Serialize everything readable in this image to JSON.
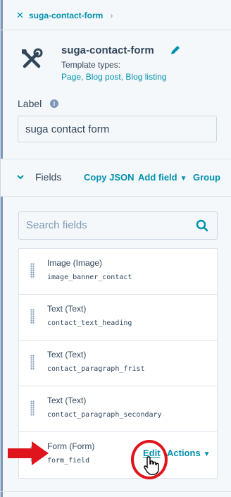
{
  "breadcrumb": {
    "label": "suga-contact-form"
  },
  "module": {
    "title": "suga-contact-form",
    "template_types_label": "Template types:",
    "template_types": "Page, Blog post, Blog listing"
  },
  "label_field": {
    "caption": "Label",
    "value": "suga contact form"
  },
  "fields_bar": {
    "title": "Fields",
    "copy_json": "Copy JSON",
    "add_field": "Add field",
    "group": "Group"
  },
  "search": {
    "placeholder": "Search fields"
  },
  "fields": [
    {
      "name": "Image (Image)",
      "id": "image_banner_contact"
    },
    {
      "name": "Text (Text)",
      "id": "contact_text_heading"
    },
    {
      "name": "Text (Text)",
      "id": "contact_paragraph_frist"
    },
    {
      "name": "Text (Text)",
      "id": "contact_paragraph_secondary"
    },
    {
      "name": "Form (Form)",
      "id": "form_field",
      "edit_label": "Edit",
      "actions_label": "Actions"
    }
  ],
  "colors": {
    "link": "#0091ae",
    "text": "#33475b",
    "annotation": "#e0141c"
  }
}
